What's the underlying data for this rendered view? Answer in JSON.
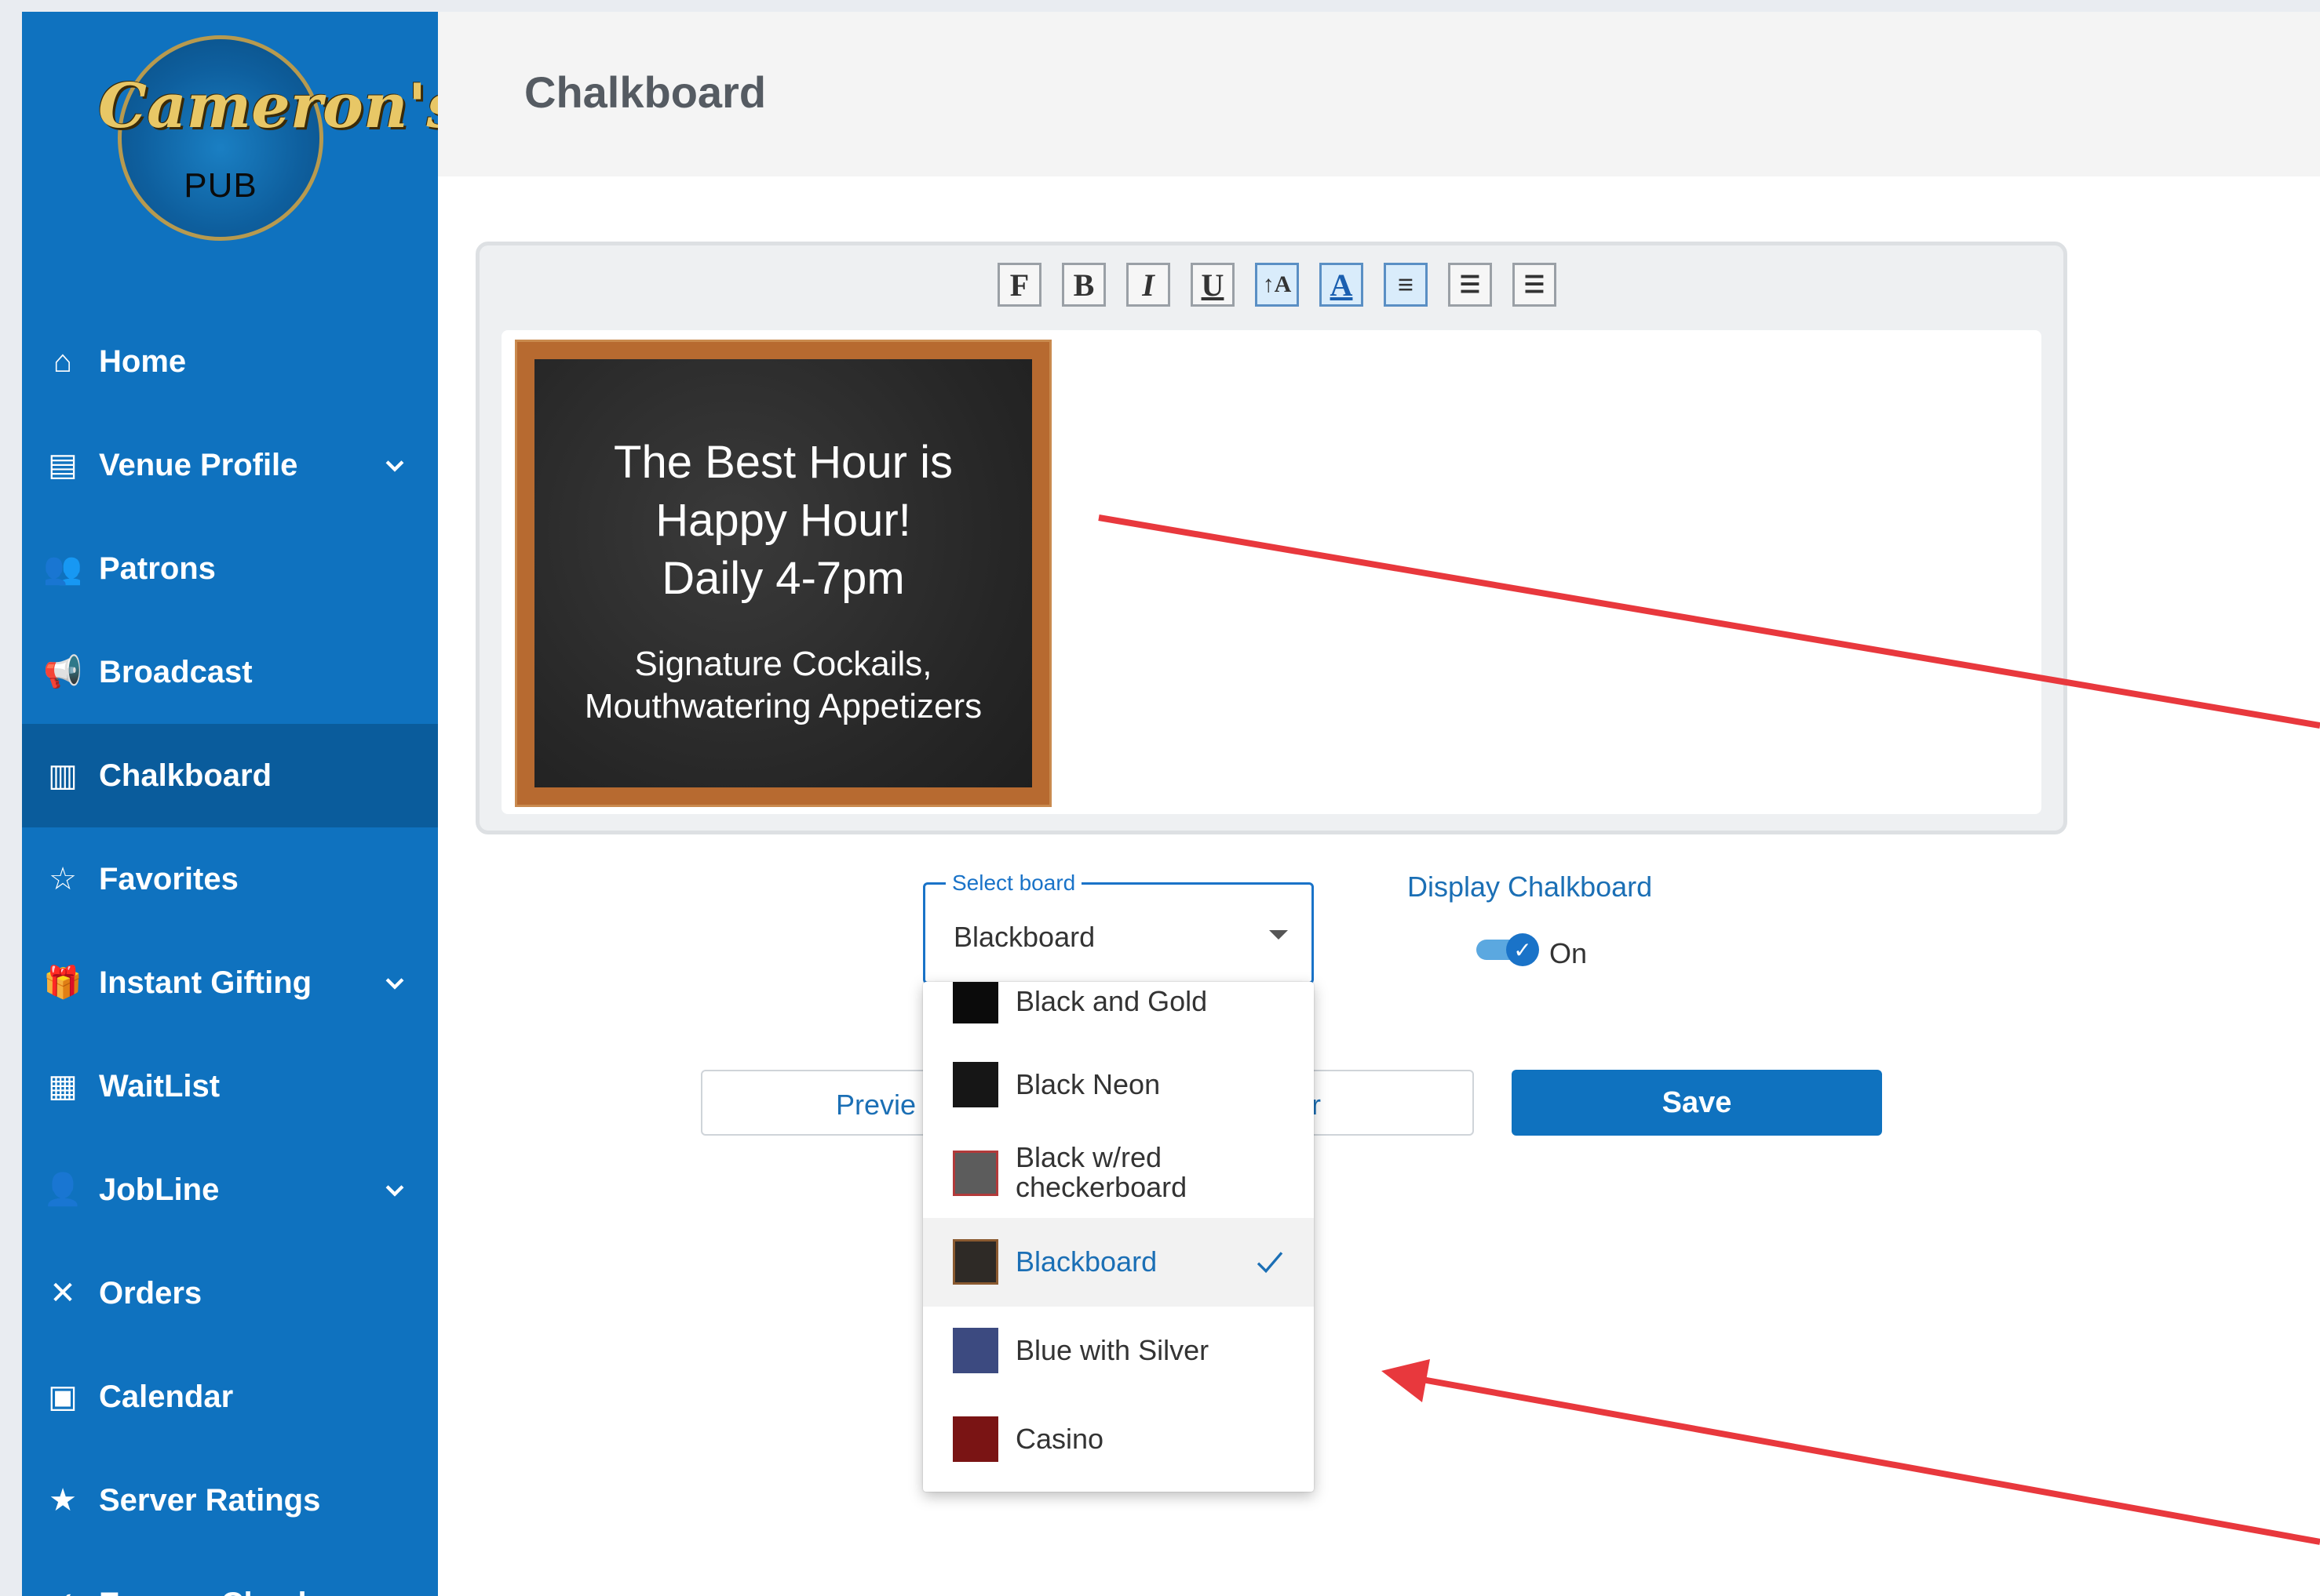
{
  "sidebar": {
    "logo": {
      "top_text": "Cameron's",
      "bottom_text": "PUB"
    },
    "items": [
      {
        "label": "Home",
        "icon": "home-icon",
        "has_chevron": false
      },
      {
        "label": "Venue Profile",
        "icon": "store-icon",
        "has_chevron": true
      },
      {
        "label": "Patrons",
        "icon": "people-icon",
        "has_chevron": false
      },
      {
        "label": "Broadcast",
        "icon": "megaphone-icon",
        "has_chevron": false
      },
      {
        "label": "Chalkboard",
        "icon": "chalkboard-icon",
        "has_chevron": false,
        "active": true
      },
      {
        "label": "Favorites",
        "icon": "star-outline-icon",
        "has_chevron": false
      },
      {
        "label": "Instant Gifting",
        "icon": "gift-icon",
        "has_chevron": true
      },
      {
        "label": "WaitList",
        "icon": "list-icon",
        "has_chevron": false
      },
      {
        "label": "JobLine",
        "icon": "person-search-icon",
        "has_chevron": true
      },
      {
        "label": "Orders",
        "icon": "utensils-icon",
        "has_chevron": false
      },
      {
        "label": "Calendar",
        "icon": "calendar-icon",
        "has_chevron": false
      },
      {
        "label": "Server Ratings",
        "icon": "star-icon",
        "has_chevron": false
      },
      {
        "label": "ExpressCheck",
        "icon": "check-icon",
        "has_chevron": false
      }
    ]
  },
  "header": {
    "title": "Chalkboard"
  },
  "editor": {
    "toolbar": [
      "F",
      "B",
      "I",
      "U",
      "↑A",
      "A",
      "≡",
      "☰",
      "☰"
    ],
    "chalkboard": {
      "headline": "The Best Hour is\nHappy Hour!\nDaily 4-7pm",
      "subline": "Signature Cockails,\nMouthwatering Appetizers"
    }
  },
  "select_board": {
    "legend": "Select board",
    "value": "Blackboard",
    "options": [
      {
        "label": "Black and Gold",
        "swatch": "#0b0b0b",
        "selected": false
      },
      {
        "label": "Black Neon",
        "swatch": "#161616",
        "selected": false
      },
      {
        "label": "Black w/red\ncheckerboard",
        "swatch": "#5c5c5c",
        "selected": false
      },
      {
        "label": "Blackboard",
        "swatch": "#2e2a26",
        "selected": true
      },
      {
        "label": "Blue with Silver",
        "swatch": "#3c4a80",
        "selected": false
      },
      {
        "label": "Casino",
        "swatch": "#7a1414",
        "selected": false
      }
    ]
  },
  "display_chalkboard": {
    "label": "Display Chalkboard",
    "state": "On"
  },
  "buttons": {
    "preview": "Previe",
    "preview_tail": "r",
    "save": "Save"
  },
  "colors": {
    "sidebar": "#0f72bf",
    "accent": "#1a73c8",
    "annotation_arrow": "#e8383d"
  }
}
